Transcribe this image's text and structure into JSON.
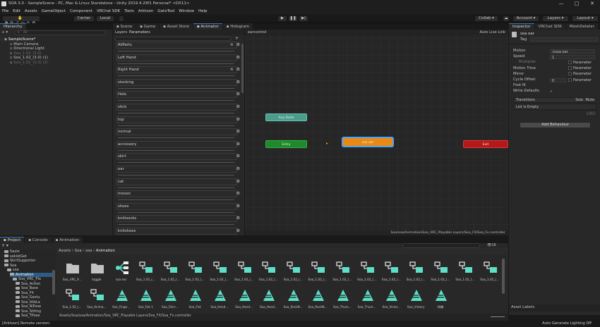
{
  "window": {
    "title": "SOA 3.0 - SampleScene - PC, Mac & Linux Standalone - Unity 2019.4.29f1 Personal* <DX11>",
    "controls": [
      "—",
      "□",
      "✕"
    ]
  },
  "menu": [
    "File",
    "Edit",
    "Assets",
    "GameObject",
    "Component",
    "VRChat SDK",
    "Tools",
    "Arktoon",
    "GatoTool",
    "Window",
    "Help"
  ],
  "toolbar": {
    "pivot": "Center",
    "space": "Local",
    "play": "▶",
    "pause": "❚❚",
    "step": "▶|",
    "collab": "Collab ▾",
    "account": "Account ▾",
    "layers": "Layers ▾",
    "layout": "Layout ▾"
  },
  "hierarchy": {
    "tab": "Hierarchy",
    "search_placeholder": "All",
    "add": "+ ▾",
    "rows": [
      {
        "label": "SampleScene*",
        "indent": 0,
        "bold": true
      },
      {
        "label": "Main Camera",
        "indent": 1
      },
      {
        "label": "Directional Light",
        "indent": 1
      },
      {
        "label": "Soa_1.02_(3.0)",
        "indent": 1,
        "dim": true
      },
      {
        "label": "Soa_1.02_(3.0) (1)",
        "indent": 1
      },
      {
        "label": "Soa_1.02_(3.0) (2)",
        "indent": 1,
        "dim": true
      }
    ]
  },
  "center_tabs": [
    "Scene",
    "Game",
    "Asset Store",
    "Animator",
    "Hologram"
  ],
  "animator": {
    "subtabs": [
      "Layers",
      "Parameters"
    ],
    "layer_path": "earcontrol",
    "auto_live_link": "Auto Live Link",
    "parameters": [
      {
        "name": "AllParts",
        "m": true
      },
      {
        "name": "Left Hand"
      },
      {
        "name": "Right Hand",
        "m": true
      },
      {
        "name": "stocking"
      },
      {
        "name": "Hole"
      },
      {
        "name": "stick"
      },
      {
        "name": "top"
      },
      {
        "name": "normal"
      },
      {
        "name": "accessory"
      },
      {
        "name": "skirt"
      },
      {
        "name": "ear"
      },
      {
        "name": "cat"
      },
      {
        "name": "mossic"
      },
      {
        "name": "shoes"
      },
      {
        "name": "kniitsocks"
      },
      {
        "name": "knitshoes"
      }
    ],
    "states": {
      "any": "Any State",
      "entry": "Entry",
      "default": "soa ear",
      "exit": "Exit"
    },
    "footer_path": "Soa/soa/Animation/Soa_VRC_Playable Layers/Soa_FX/Soa_Fx.controller"
  },
  "inspector": {
    "tabs": [
      "Inspector",
      "VRChat SDK",
      "MeshDeleter"
    ],
    "object_name": "soa ear",
    "tag_label": "Tag",
    "fields": [
      {
        "label": "Motion",
        "value": "⊙soa ear"
      },
      {
        "label": "Speed",
        "value": "1"
      },
      {
        "label": "Multiplier",
        "value": "",
        "param": "Parameter"
      },
      {
        "label": "Motion Time",
        "value": "",
        "param": "Parameter"
      },
      {
        "label": "Mirror",
        "value": "",
        "param": "Parameter"
      },
      {
        "label": "Cycle Offset",
        "value": "0",
        "param": "Parameter"
      },
      {
        "label": "Foot IK",
        "value": ""
      },
      {
        "label": "Write Defaults",
        "value": "✓"
      }
    ],
    "transitions_label": "Transitions",
    "solo": "Solo",
    "mute": "Mute",
    "list_empty": "List is Empty",
    "add_behaviour": "Add Behaviour",
    "asset_labels": "Asset Labels"
  },
  "project": {
    "tabs": [
      "Project",
      "Console",
      "Animation"
    ],
    "tree": [
      {
        "label": "Saxie",
        "indent": 1
      },
      {
        "label": "seklotGet",
        "indent": 1
      },
      {
        "label": "SkirtSupporter",
        "indent": 1
      },
      {
        "label": "Soa",
        "indent": 1
      },
      {
        "label": "soa",
        "indent": 2
      },
      {
        "label": "Animation",
        "indent": 3,
        "selected": true
      },
      {
        "label": "Soa_VRC_Pla",
        "indent": 4
      },
      {
        "label": "Soa_Action",
        "indent": 5
      },
      {
        "label": "Soa_Base",
        "indent": 5
      },
      {
        "label": "Soa_FX",
        "indent": 5
      },
      {
        "label": "Soa_Gestu",
        "indent": 5
      },
      {
        "label": "Soa_IdleLa",
        "indent": 5
      },
      {
        "label": "Soa_IKPose",
        "indent": 5
      },
      {
        "label": "Soa_Sitting",
        "indent": 5
      },
      {
        "label": "Soa_TPose",
        "indent": 5
      }
    ],
    "breadcrumb": [
      "Assets",
      "Soa",
      "soa",
      "Animation"
    ],
    "count": "16",
    "assets_row1": [
      {
        "name": "Soa_VRC_P...",
        "type": "folder"
      },
      {
        "name": "toggle",
        "type": "folder"
      },
      {
        "name": "soa ear",
        "type": "tree"
      },
      {
        "name": "Soa_1.02_(...",
        "type": "clip"
      },
      {
        "name": "Soa_1.02_(...",
        "type": "clip"
      },
      {
        "name": "Soa_1.02_(...",
        "type": "clip"
      },
      {
        "name": "Soa_1.02_(...",
        "type": "clip"
      },
      {
        "name": "Soa_1.02_(...",
        "type": "clip"
      },
      {
        "name": "Soa_1.02_(...",
        "type": "clip"
      },
      {
        "name": "Soa_1.02_(...",
        "type": "clip"
      },
      {
        "name": "Soa_1.02_(...",
        "type": "clip"
      },
      {
        "name": "Soa_1.02_(...",
        "type": "clip"
      },
      {
        "name": "Soa_1.02_(...",
        "type": "clip"
      },
      {
        "name": "Soa_1.02_(...",
        "type": "clip"
      },
      {
        "name": "Soa_1.02_(...",
        "type": "clip"
      },
      {
        "name": "Soa_1.02_(...",
        "type": "clip"
      },
      {
        "name": "Soa_1.02_(...",
        "type": "clip"
      },
      {
        "name": "Soa_1.02_(...",
        "type": "clip"
      }
    ],
    "assets_row2": [
      {
        "name": "Soa_1.02_(...",
        "type": "clip"
      },
      {
        "name": "Soa_Anima...",
        "type": "clip"
      },
      {
        "name": "Soa_Finge...",
        "type": "anim"
      },
      {
        "name": "Soa_Fist 1",
        "type": "anim"
      },
      {
        "name": "Soa_Fist+...",
        "type": "anim"
      },
      {
        "name": "Soa_Fist",
        "type": "anim"
      },
      {
        "name": "Soa_Hand...",
        "type": "anim"
      },
      {
        "name": "Soa_Hand...",
        "type": "anim"
      },
      {
        "name": "Soa_Hand...",
        "type": "anim"
      },
      {
        "name": "Soa_RockN...",
        "type": "anim"
      },
      {
        "name": "Soa_RockN...",
        "type": "anim"
      },
      {
        "name": "Soa_Thum...",
        "type": "anim"
      },
      {
        "name": "Soa_Thum...",
        "type": "anim"
      },
      {
        "name": "Soa_Victor...",
        "type": "anim"
      },
      {
        "name": "Soa_Victory",
        "type": "anim"
      },
      {
        "name": "待機",
        "type": "anim"
      }
    ],
    "footer_path": "Assets/Soa/soa/Animation/Soa_VRC_Playable Layers/Soa_FX/Soa_Fx.controller"
  },
  "status": {
    "left": "[Arktoon] Remote version:",
    "right": "Auto Generate Lighting Off"
  },
  "colors": {
    "accent": "#3a79bb",
    "any_state": "#4a9c8d",
    "entry": "#1f8a2c",
    "default_state": "#e88a12",
    "exit": "#b51818",
    "asset_teal": "#5ee0c8"
  }
}
